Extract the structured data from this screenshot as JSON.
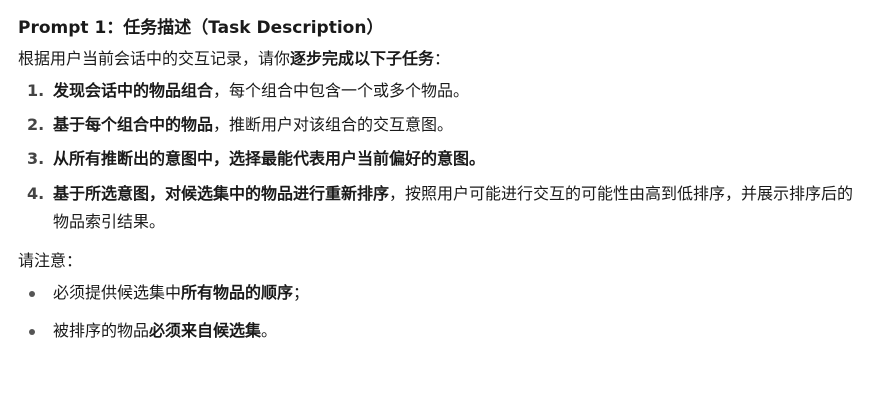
{
  "title": "Prompt 1：任务描述（Task Description）",
  "intro": {
    "text": "根据用户当前会话中的交互记录，请你",
    "bold": "逐步完成以下子任务",
    "end": "："
  },
  "steps": [
    {
      "num": "1.",
      "bold": "发现会话中的物品组合",
      "rest": "，每个组合中包含一个或多个物品。"
    },
    {
      "num": "2.",
      "bold": "基于每个组合中的物品",
      "rest": "，推断用户对该组合的交互意图。"
    },
    {
      "num": "3.",
      "bold": "从所有推断出的意图中，选择最能代表用户当前偏好的意图。",
      "rest": ""
    },
    {
      "num": "4.",
      "bold": "基于所选意图，对候选集中的物品进行重新排序",
      "rest": "，按照用户可能进行交互的可能性由高到低排序，并展示排序后的物品索引结果。"
    }
  ],
  "note_label": "请注意：",
  "notes": [
    {
      "pre": "必须提供候选集中",
      "bold": "所有物品的顺序",
      "post": "；"
    },
    {
      "pre": "被排序的物品",
      "bold": "必须来自候选集",
      "post": "。"
    }
  ]
}
